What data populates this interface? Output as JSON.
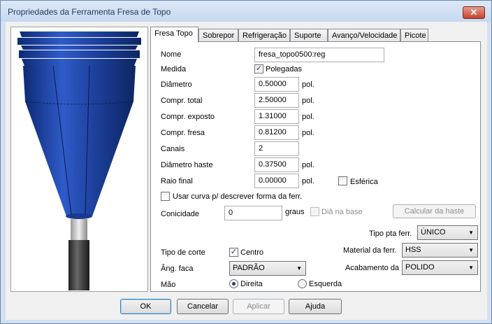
{
  "window": {
    "title": "Propriedades da Ferramenta Fresa de Topo",
    "close_glyph": "✕"
  },
  "tabs": [
    {
      "label": "Fresa Topo"
    },
    {
      "label": "Sobrepor"
    },
    {
      "label": "Refrigeração"
    },
    {
      "label": "Suporte"
    },
    {
      "label": "Avanço/Velocidade"
    },
    {
      "label": "Picote"
    }
  ],
  "form": {
    "nome": {
      "label": "Nome",
      "value": "fresa_topo0500:reg"
    },
    "medida": {
      "label": "Medida",
      "checkbox_label": "Polegadas",
      "checked": true
    },
    "diametro": {
      "label": "Diâmetro",
      "value": "0.50000",
      "unit": "pol."
    },
    "compr_total": {
      "label": "Compr. total",
      "value": "2.50000",
      "unit": "pol."
    },
    "compr_exposto": {
      "label": "Compr. exposto",
      "value": "1.31000",
      "unit": "pol."
    },
    "compr_fresa": {
      "label": "Compr. fresa",
      "value": "0.81200",
      "unit": "pol."
    },
    "canais": {
      "label": "Canais",
      "value": "2"
    },
    "diametro_haste": {
      "label": "Diâmetro haste",
      "value": "0.37500",
      "unit": "pol."
    },
    "raio_final": {
      "label": "Raio final",
      "value": "0.00000",
      "unit": "pol."
    },
    "esferica": {
      "label": "Esférica",
      "checked": false
    },
    "usar_curva": {
      "label": "Usar curva p/ descrever forma da ferr.",
      "checked": false
    },
    "conicidade": {
      "label": "Conicidade",
      "value": "0",
      "unit": "graus"
    },
    "dia_na_base": {
      "label": "Diâ na base",
      "checked": false
    },
    "calcular_haste": "Calcular da haste",
    "tipo_pta": {
      "label": "Tipo pta ferr.",
      "value": "ÚNICO"
    },
    "tipo_corte": {
      "label": "Tipo de corte",
      "checkbox_label": "Centro",
      "checked": true
    },
    "material": {
      "label": "Material da ferr.",
      "value": "HSS"
    },
    "ang_face": {
      "label": "Âng. faca",
      "value": "PADRÃO"
    },
    "acabamento": {
      "label": "Acabamento da",
      "value": "POLIDO"
    },
    "mao": {
      "label": "Mão",
      "option_right": "Direita",
      "option_left": "Esquerda",
      "selected": "Direita"
    }
  },
  "buttons": {
    "ok": "OK",
    "cancel": "Cancelar",
    "apply": "Aplicar",
    "help": "Ajuda"
  },
  "colors": {
    "tool_body": "#1c3f9a",
    "tool_dark": "#0f2460",
    "shank": "#3a3a3a"
  }
}
